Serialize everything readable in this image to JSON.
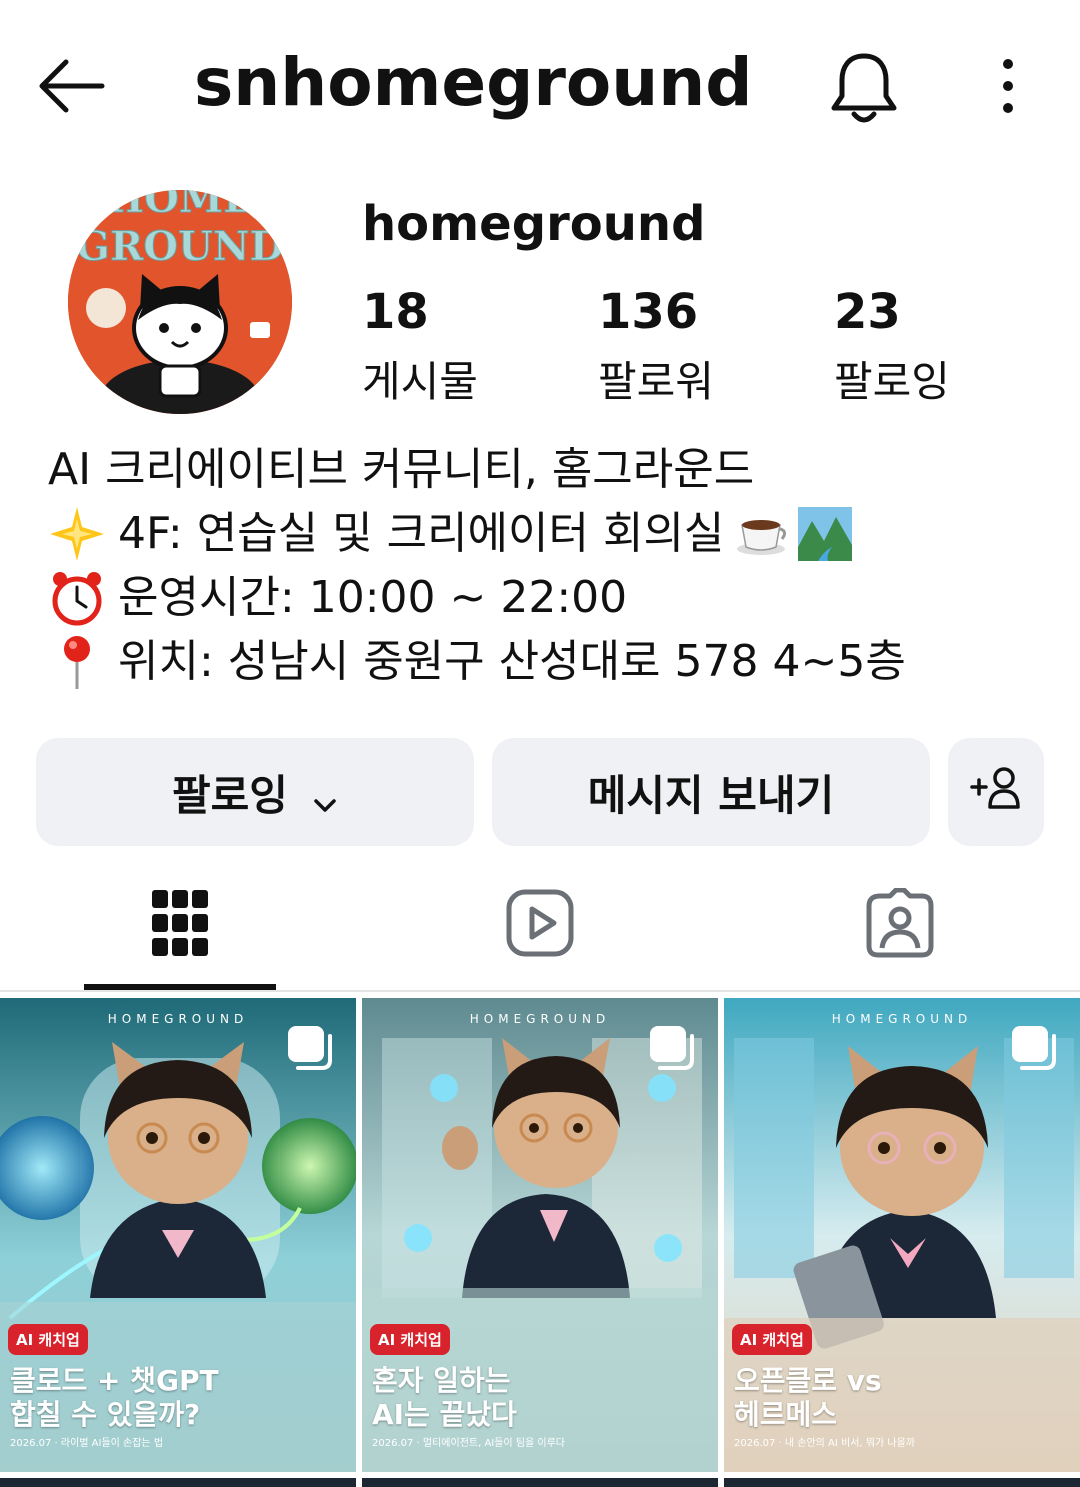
{
  "header": {
    "back_icon": "back-arrow-icon",
    "username": "snhomeground",
    "bell_icon": "bell-icon",
    "more_icon": "more-vertical-icon"
  },
  "profile": {
    "avatar_text": "HOME GROUND",
    "display_name": "homeground",
    "stats": {
      "posts": {
        "num": "18",
        "label": "게시물"
      },
      "followers": {
        "num": "136",
        "label": "팔로워"
      },
      "following": {
        "num": "23",
        "label": "팔로잉"
      }
    }
  },
  "bio": {
    "line1": "AI 크리에이티브 커뮤니티, 홈그라운드",
    "line2": "4F: 연습실 및 크리에이터 회의실",
    "line3": "운영시간: 10:00 ~ 22:00",
    "line4": "위치: 성남시 중원구 산성대로 578 4~5층"
  },
  "buttons": {
    "follow": "팔로잉",
    "message": "메시지 보내기",
    "add_user_icon": "add-user-icon"
  },
  "tabs": [
    {
      "icon": "grid-icon",
      "active": true
    },
    {
      "icon": "reels-icon",
      "active": false
    },
    {
      "icon": "tagged-icon",
      "active": false
    }
  ],
  "posts": [
    {
      "brand": "HOMEGROUND",
      "badge": "AI 캐치업",
      "title1": "클로드 + 챗GPT",
      "title2": "합칠 수 있을까?",
      "caption": "2026.07 · 라이벌 AI들이 손잡는 법"
    },
    {
      "brand": "HOMEGROUND",
      "badge": "AI 캐치업",
      "title1": "혼자 일하는",
      "title2": "AI는 끝났다",
      "caption": "2026.07 · 멀티에이전트, AI들이 팀을 이루다"
    },
    {
      "brand": "HOMEGROUND",
      "badge": "AI 캐치업",
      "title1": "오픈클로 vs",
      "title2": "헤르메스",
      "caption": "2026.07 · 내 손안의 AI 비서, 뭐가 나을까"
    }
  ],
  "colors": {
    "button_bg": "#eff1f4",
    "badge_red": "#d8222c",
    "avatar_orange": "#e2542c"
  }
}
